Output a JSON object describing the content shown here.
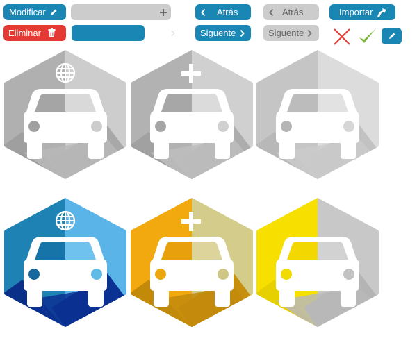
{
  "buttons": {
    "modify_label": "Modificar",
    "delete_label": "Eliminar",
    "back_label": "Atrás",
    "back_disabled_label": "Atrás",
    "next_label": "Siguente",
    "next_disabled_label": "Siguente",
    "import_label": "Importar"
  },
  "colors": {
    "primary_blue": "#1a86b4",
    "danger_red": "#e53a33",
    "disabled_grey": "#cccccc",
    "cancel_x_red": "#e53a33",
    "confirm_check_green": "#7ab43c"
  },
  "tiles": [
    {
      "variant": "grey-globe",
      "icon": "car-icon",
      "badge": "globe-icon"
    },
    {
      "variant": "grey-plus",
      "icon": "car-icon",
      "badge": "plus-icon"
    },
    {
      "variant": "grey-plain",
      "icon": "car-icon",
      "badge": ""
    },
    {
      "variant": "blue-globe",
      "icon": "car-icon",
      "badge": "globe-icon"
    },
    {
      "variant": "orange-plus",
      "icon": "car-icon",
      "badge": "plus-icon"
    },
    {
      "variant": "yellow-plain",
      "icon": "car-icon",
      "badge": ""
    }
  ]
}
